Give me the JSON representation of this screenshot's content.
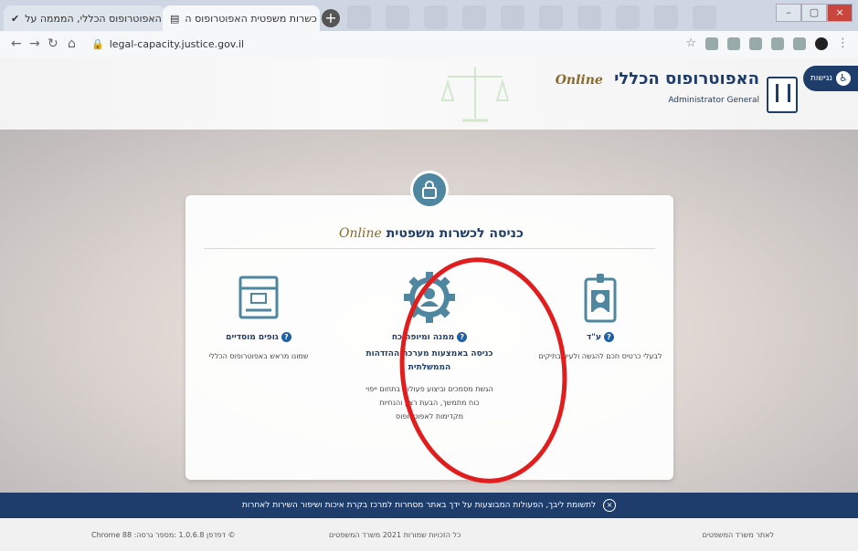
{
  "browser": {
    "tabs": [
      {
        "title": "האפוטרופוס הכללי, המממה על"
      },
      {
        "title": "כשרות משפטית האפוטרופוס ה"
      }
    ],
    "url": "legal-capacity.justice.gov.il"
  },
  "header": {
    "title": "האפוטרופוס הכללי",
    "online": "Online",
    "subtitle": "Administrator General",
    "accessibility_label": "נגישות"
  },
  "card": {
    "title": "כניסה לכשרות משפטית",
    "online": "Online",
    "options": [
      {
        "label": "ע\"ד",
        "description": "לבעלי כרטיס חכם להגשה ולעיון בתיקים"
      },
      {
        "label": "ממנה ומיופה כח",
        "subtitle": "כניסה באמצעות מערכת ההזדהות הממשלתית",
        "description": "הגשת מסמכים וביצוע פעולות בתחום ייפוי כוח מתמשך, הבעת רצון והנחיות מקדימות לאפוטרופוס"
      },
      {
        "label": "גופים מוסדיים",
        "description": "שמונו מראש באפוטרופוס הכללי"
      }
    ]
  },
  "banner": {
    "text": "לתשומת ליבך, הפעולות המבוצעות על ידך באתר מסחרות למרכז בקרת איכות ושיפור השירות לאחרות"
  },
  "footer": {
    "left": "Chrome 88 :דפדפן  1.0.6.8 :מספר גרסה  ©",
    "middle": "כל הזכויות שמורות 2021 משרד המשפטים",
    "right": "לאתר משרד המשפטים"
  },
  "colors": {
    "brand": "#1e3d6b",
    "accent": "#4f86a0",
    "highlight": "#e11d1d"
  }
}
